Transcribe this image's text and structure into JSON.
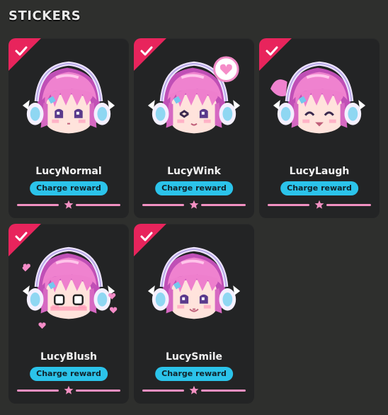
{
  "section": {
    "title": "STICKERS"
  },
  "colors": {
    "card_bg": "#232425",
    "check_corner": "#e8245c",
    "reward_badge": "#2bc3ea",
    "progress": "#f290c2"
  },
  "stickers": [
    {
      "name": "LucyNormal",
      "reward_label": "Charge reward",
      "expression": "normal",
      "checked": true,
      "icon": "check-icon"
    },
    {
      "name": "LucyWink",
      "reward_label": "Charge reward",
      "expression": "wink-heart",
      "checked": true,
      "icon": "check-icon"
    },
    {
      "name": "LucyLaugh",
      "reward_label": "Charge reward",
      "expression": "laugh",
      "checked": true,
      "icon": "check-icon"
    },
    {
      "name": "LucyBlush",
      "reward_label": "Charge reward",
      "expression": "blush-hearts",
      "checked": true,
      "icon": "check-icon"
    },
    {
      "name": "LucySmile",
      "reward_label": "Charge reward",
      "expression": "smile",
      "checked": true,
      "icon": "check-icon"
    }
  ]
}
